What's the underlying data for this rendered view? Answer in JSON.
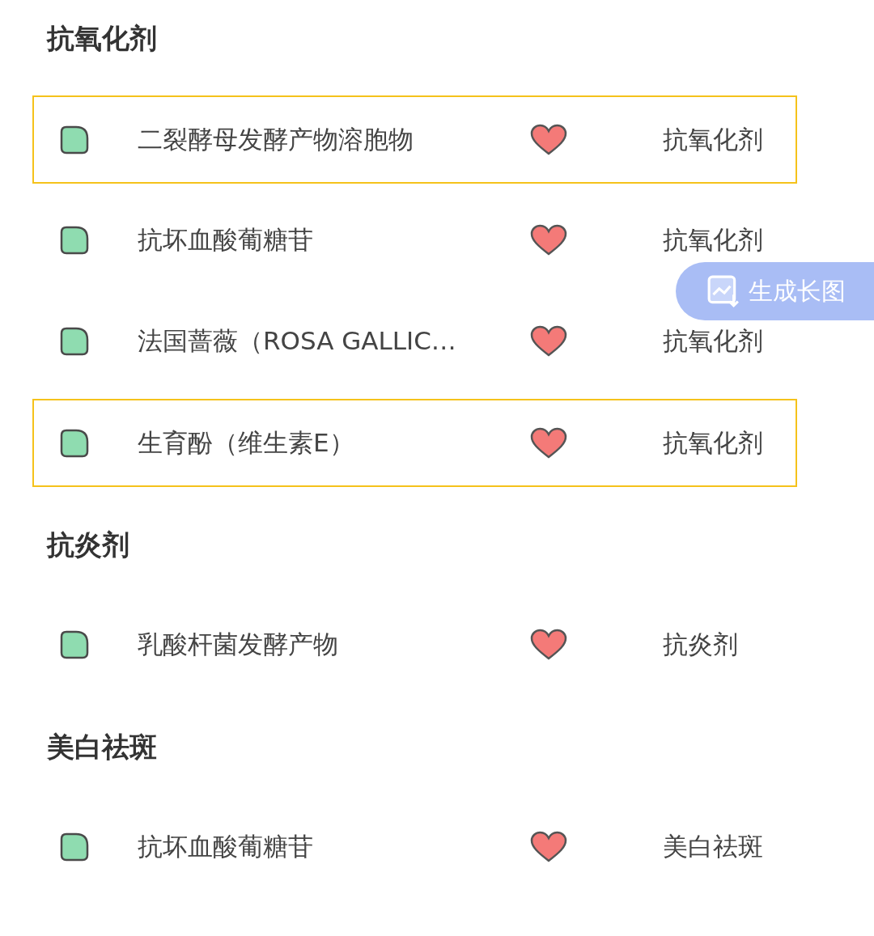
{
  "sections": [
    {
      "heading": "抗氧化剂",
      "items": [
        {
          "name": "二裂酵母发酵产物溶胞物",
          "category": "抗氧化剂",
          "selected": true
        },
        {
          "name": "抗坏血酸葡糖苷",
          "category": "抗氧化剂",
          "selected": false
        },
        {
          "name": "法国蔷薇（ROSA GALLIC…",
          "category": "抗氧化剂",
          "selected": false
        },
        {
          "name": "生育酚（维生素E）",
          "category": "抗氧化剂",
          "selected": true
        }
      ]
    },
    {
      "heading": "抗炎剂",
      "items": [
        {
          "name": "乳酸杆菌发酵产物",
          "category": "抗炎剂",
          "selected": false
        }
      ]
    },
    {
      "heading": "美白祛斑",
      "items": [
        {
          "name": "抗坏血酸葡糖苷",
          "category": "美白祛斑",
          "selected": false
        }
      ]
    }
  ],
  "float_button": {
    "label": "生成长图"
  }
}
